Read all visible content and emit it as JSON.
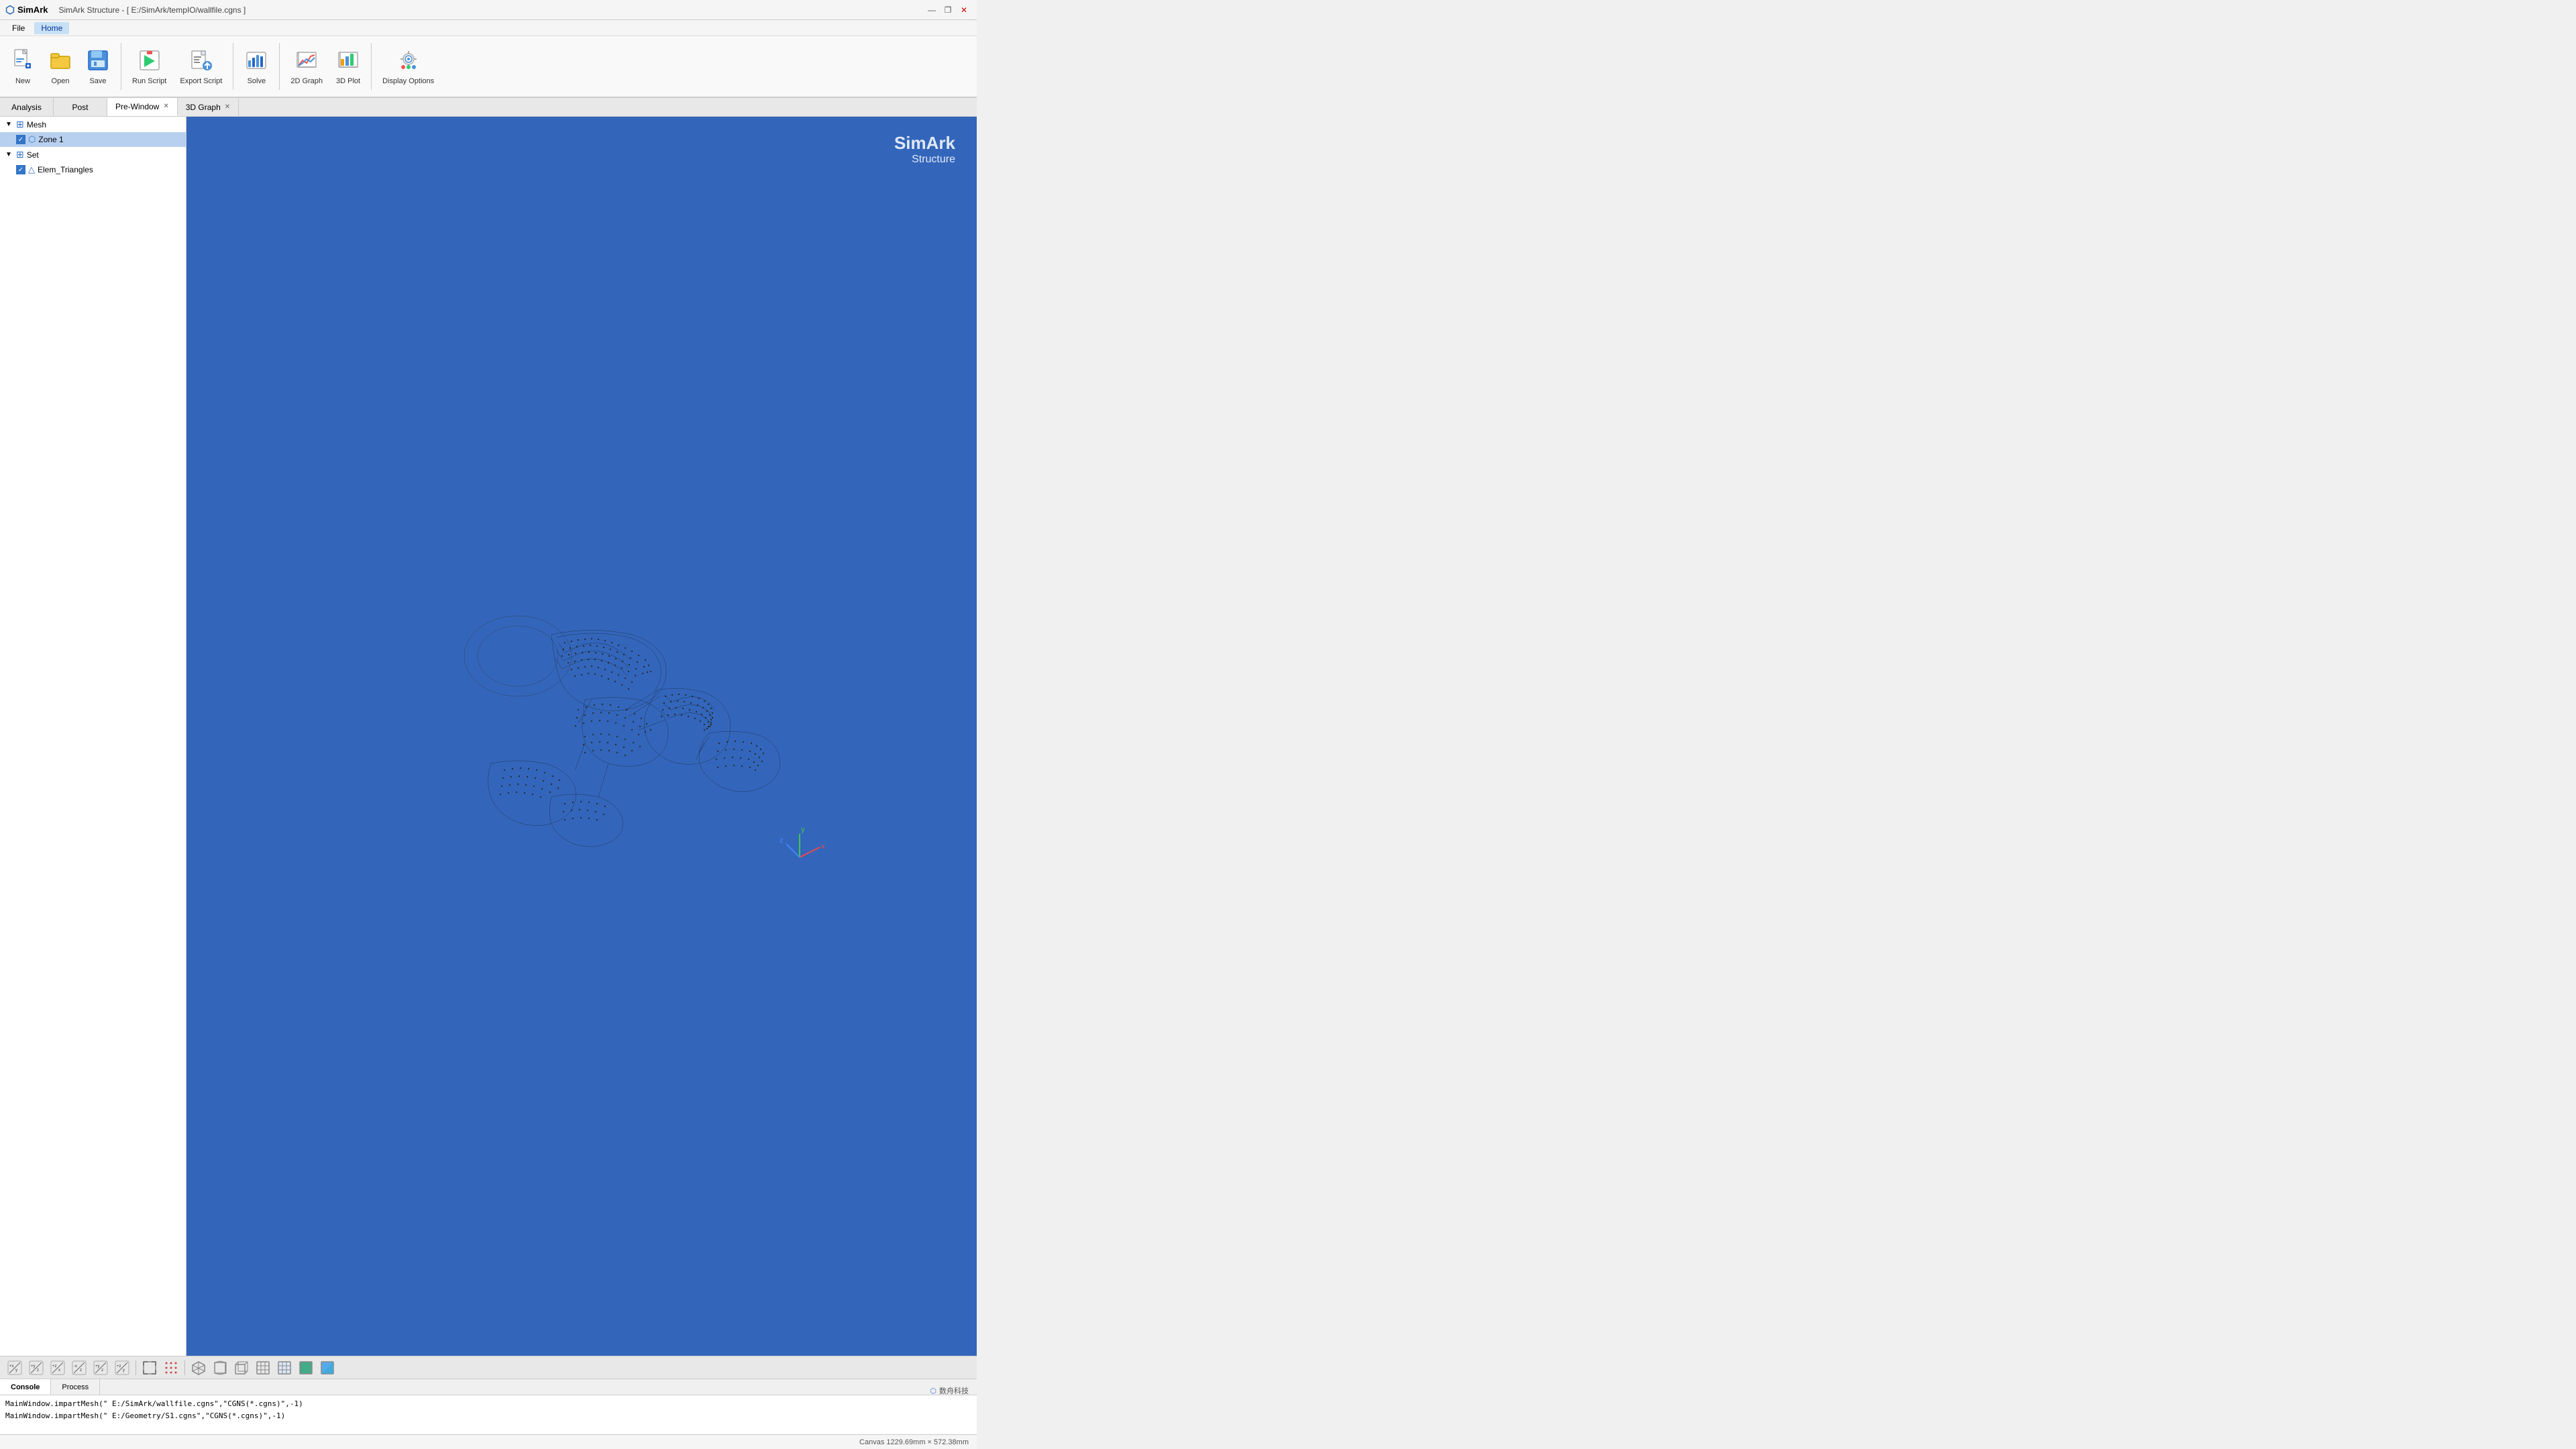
{
  "app": {
    "name": "SimArk",
    "window_title": "SimArk Structure - [ E:/SimArk/tempIO/wallfile.cgns ]"
  },
  "menu": {
    "items": [
      "File",
      "Home"
    ]
  },
  "menu_active": "Home",
  "ribbon": {
    "buttons": [
      {
        "id": "new",
        "label": "New"
      },
      {
        "id": "open",
        "label": "Open"
      },
      {
        "id": "save",
        "label": "Save"
      },
      {
        "id": "run-script",
        "label": "Run Script"
      },
      {
        "id": "export-script",
        "label": "Export Script"
      },
      {
        "id": "solve",
        "label": "Solve"
      },
      {
        "id": "2d-graph",
        "label": "2D Graph"
      },
      {
        "id": "3d-plot",
        "label": "3D Plot"
      },
      {
        "id": "display-options",
        "label": "Display Options"
      }
    ]
  },
  "tabs": {
    "sections": [
      "Analysis",
      "Post"
    ],
    "tabs": [
      {
        "id": "pre-window",
        "label": "Pre-Window",
        "closable": true
      },
      {
        "id": "3d-graph",
        "label": "3D Graph",
        "closable": true
      }
    ],
    "active": "pre-window"
  },
  "tree": {
    "items": [
      {
        "id": "mesh",
        "label": "Mesh",
        "level": 0,
        "type": "group",
        "expanded": true,
        "checkbox": false
      },
      {
        "id": "zone1",
        "label": "Zone 1",
        "level": 1,
        "type": "item",
        "checked": true
      },
      {
        "id": "set",
        "label": "Set",
        "level": 0,
        "type": "group",
        "expanded": true,
        "checkbox": false
      },
      {
        "id": "elem-triangles",
        "label": "Elem_Triangles",
        "level": 1,
        "type": "item",
        "checked": true
      }
    ]
  },
  "viewport": {
    "brand_title": "SimArk",
    "brand_subtitle": "Structure",
    "background_color": "#3366bb"
  },
  "console": {
    "tabs": [
      "Console",
      "Process"
    ],
    "active_tab": "Console",
    "lines": [
      "MainWindow.impartMesh(\" E:/SimArk/wallfile.cgns\",\"CGNS(*.cgns)\",-1)",
      "MainWindow.impartMesh(\" E:/Geometry/S1.cgns\",\"CGNS(*.cgns)\",-1)"
    ]
  },
  "status_bar": {
    "canvas_info": "Canvas  1229.69mm × 572.38mm"
  },
  "brand": {
    "company": "数舟科技"
  },
  "window_controls": {
    "minimize": "—",
    "restore": "❐",
    "close": "✕"
  }
}
